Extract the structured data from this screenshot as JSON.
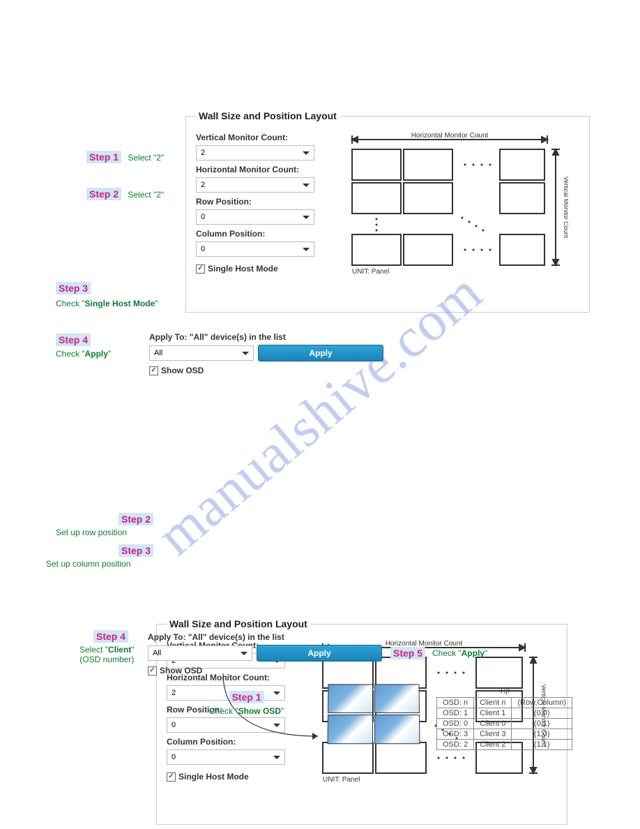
{
  "watermark": "manualshive.com",
  "panel1": {
    "legend": "Wall Size and Position Layout",
    "vmc_label": "Vertical Monitor Count:",
    "vmc_value": "2",
    "hmc_label": "Horizontal Monitor Count:",
    "hmc_value": "2",
    "row_label": "Row Position:",
    "row_value": "0",
    "col_label": "Column Position:",
    "col_value": "0",
    "single_host": "Single Host Mode",
    "diagram_h": "Horizontal Monitor Count",
    "diagram_v": "Vertical Monitor Count",
    "diagram_unit": "UNIT: Panel"
  },
  "apply1": {
    "title": "Apply To: \"All\" device(s) in the list",
    "select_value": "All",
    "button": "Apply",
    "show_osd": "Show OSD"
  },
  "panel2": {
    "legend": "Wall Size and Position Layout",
    "vmc_label": "Vertical Monitor Count:",
    "vmc_value": "2",
    "hmc_label": "Horizontal Monitor Count:",
    "hmc_value": "2",
    "row_label": "Row Position:",
    "row_value": "0",
    "col_label": "Column Position:",
    "col_value": "0",
    "single_host": "Single Host Mode",
    "diagram_h": "Horizontal Monitor Count",
    "diagram_v": "Vertical Monitor Count",
    "diagram_unit": "UNIT: Panel"
  },
  "apply2": {
    "title": "Apply To: \"All\" device(s) in the list",
    "select_value": "All",
    "button": "Apply",
    "show_osd": "Show OSD"
  },
  "annotations": {
    "s1a": "Step 1",
    "s1a_note": "Select \"2\"",
    "s2a": "Step 2",
    "s2a_note": "Select \"2\"",
    "s3a": "Step 3",
    "s3a_note_prefix": "Check \"",
    "s3a_note_bold": "Single Host Mode",
    "s3a_note_suffix": "\"",
    "s4a": "Step 4",
    "s4a_note_prefix": "Check \"",
    "s4a_note_bold": "Apply",
    "s4a_note_suffix": "\"",
    "s2b": "Step 2",
    "s2b_note": "Set up row position",
    "s3b": "Step 3",
    "s3b_note": "Set up column position",
    "s4b": "Step 4",
    "s4b_note_prefix": "Select \"",
    "s4b_note_bold": "Client",
    "s4b_note_suffix": "\"",
    "s4b_note_line2": "(OSD number)",
    "s5b": "Step 5",
    "s5b_note_prefix": "Check \"",
    "s5b_note_bold": "Apply",
    "s5b_note_suffix": "\"",
    "s1b": "Step 1",
    "s1b_note_prefix": "Check \"",
    "s1b_note_bold": "Show OSD",
    "s1b_note_suffix": "\""
  },
  "tip": {
    "title": "Tip",
    "headers": [
      "OSD: n",
      "Client n",
      "(Row,Column)"
    ],
    "rows": [
      [
        "OSD: 1",
        "Client 1",
        "(0,0)"
      ],
      [
        "OSD: 0",
        "Client 0",
        "(0,1)"
      ],
      [
        "OSD: 3",
        "Client 3",
        "(1,0)"
      ],
      [
        "OSD: 2",
        "Client 2",
        "(1,1)"
      ]
    ]
  }
}
